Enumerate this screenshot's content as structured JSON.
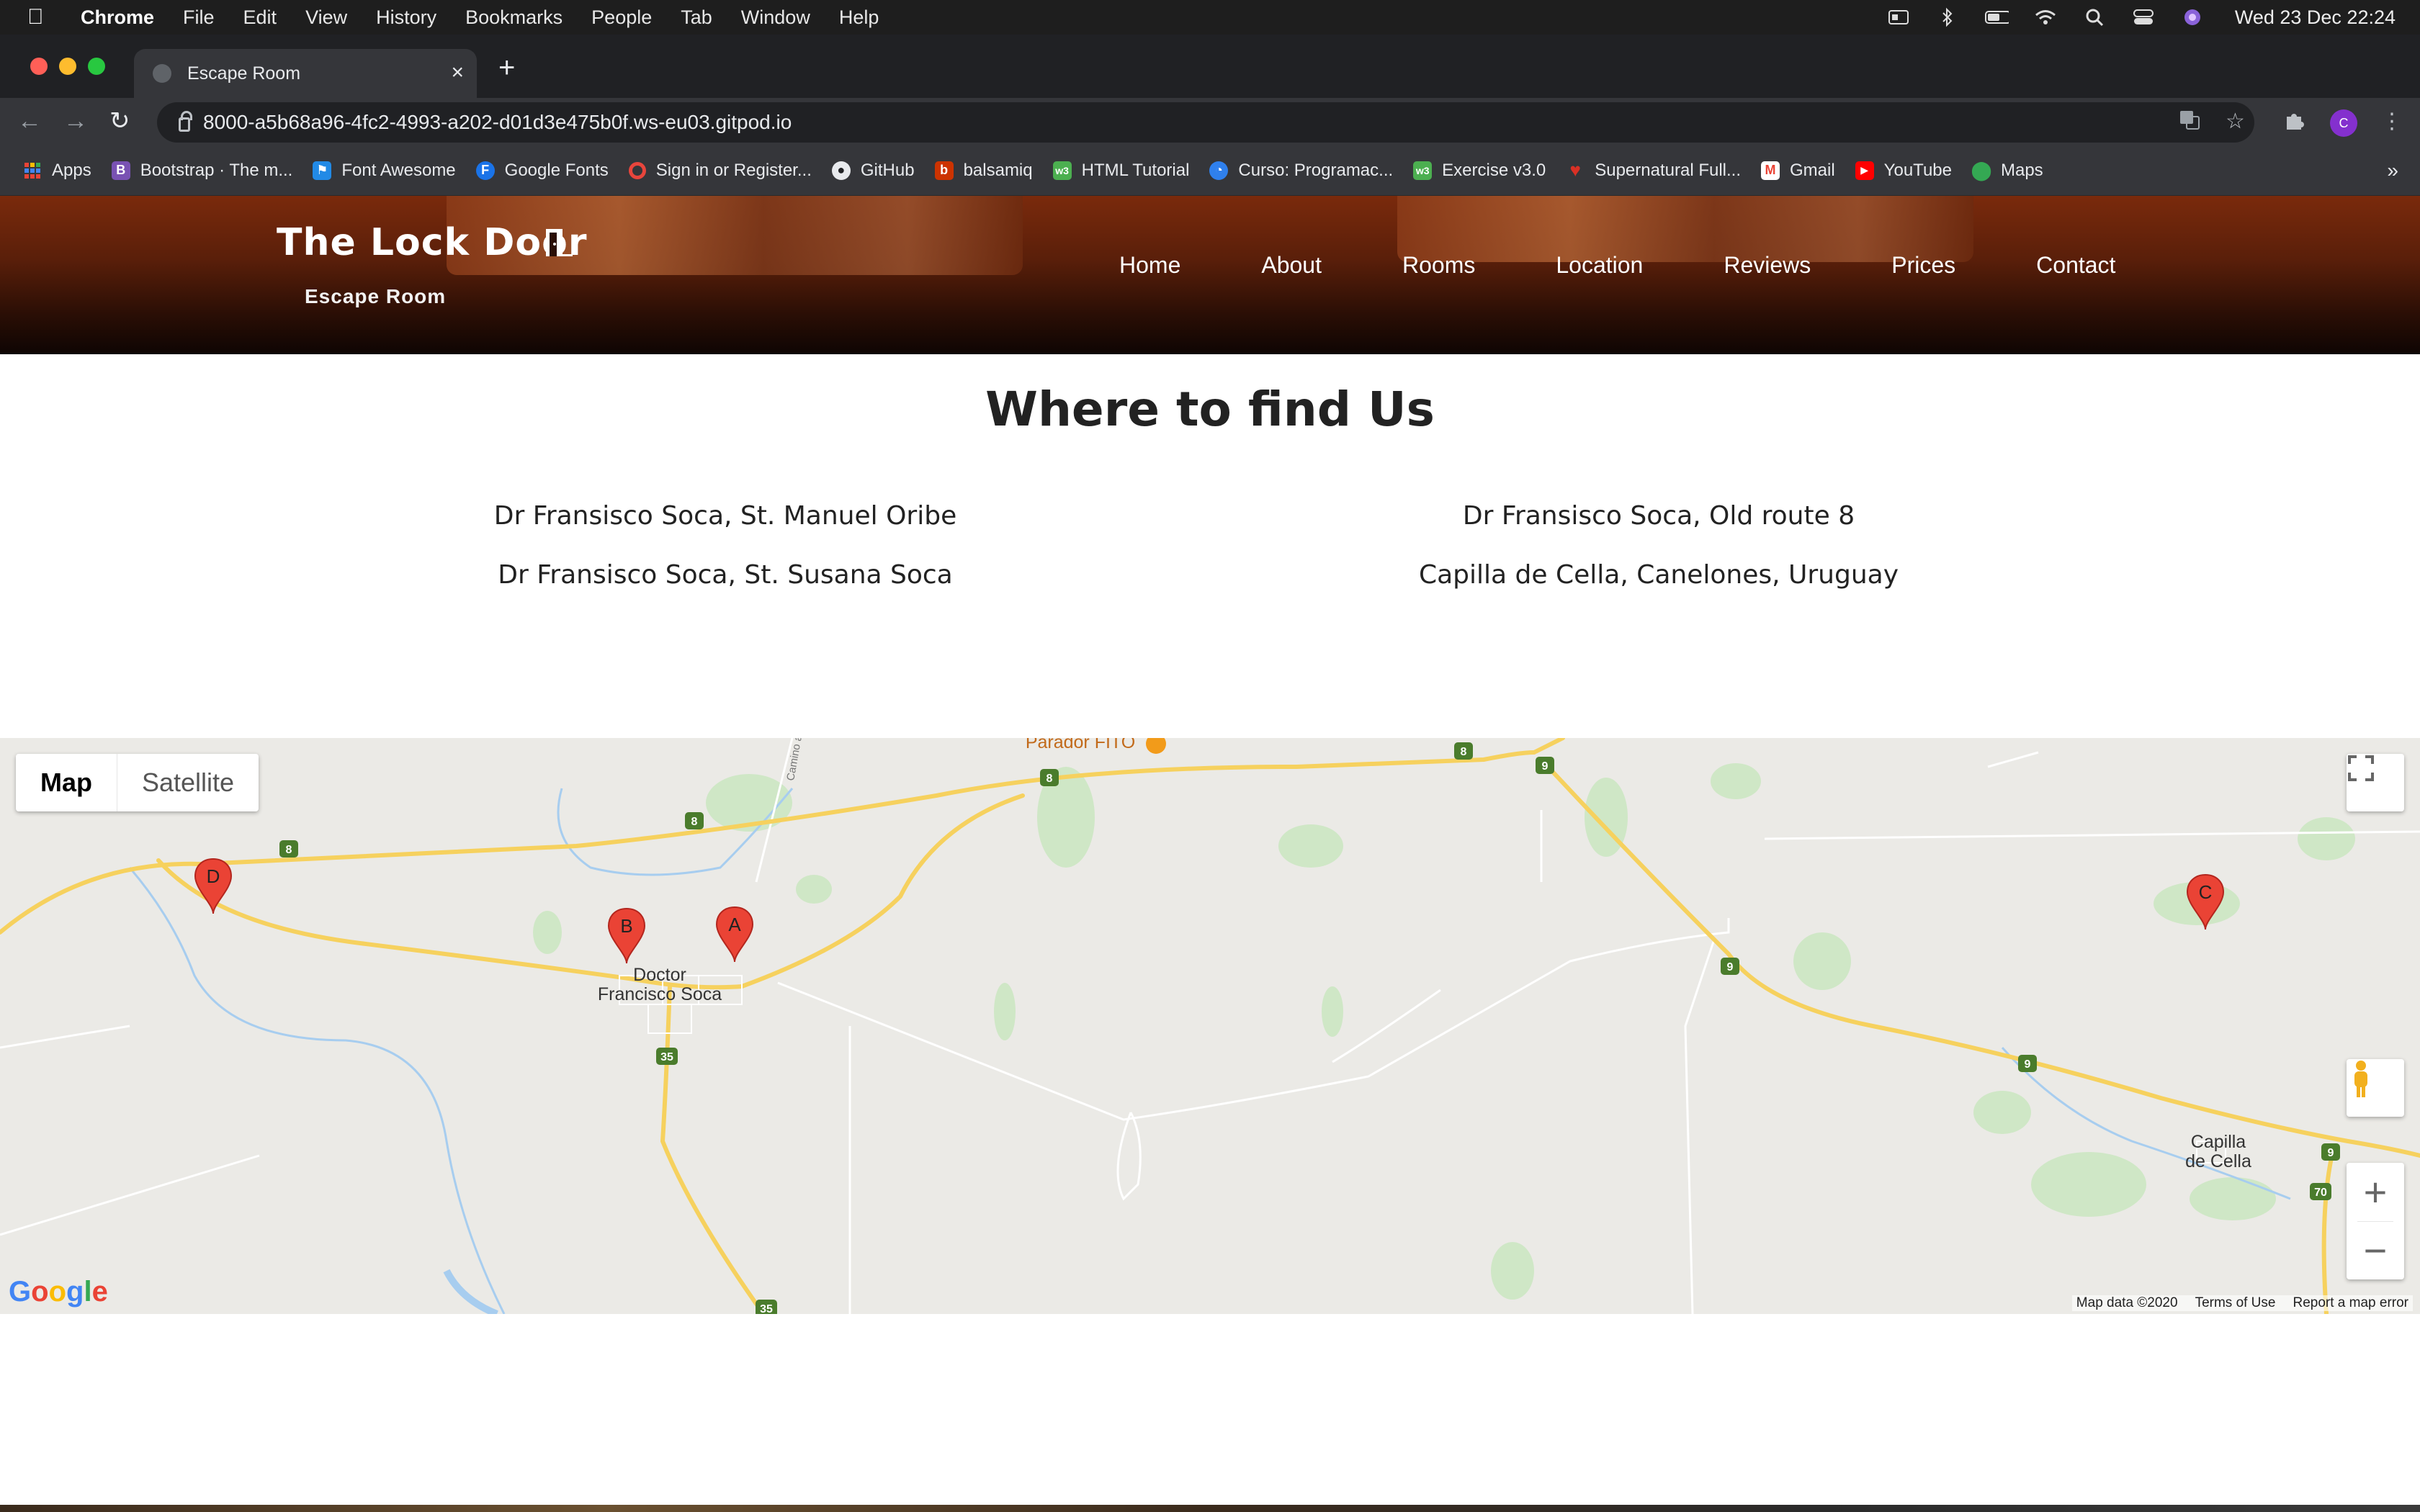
{
  "menubar": {
    "app_name": "Chrome",
    "items": [
      "File",
      "Edit",
      "View",
      "History",
      "Bookmarks",
      "People",
      "Tab",
      "Window",
      "Help"
    ],
    "clock": "Wed 23 Dec  22:24"
  },
  "browser": {
    "tab_title": "Escape Room",
    "url": "8000-a5b68a96-4fc2-4993-a202-d01d3e475b0f.ws-eu03.gitpod.io",
    "profile_initial": "C",
    "bookmarks": [
      {
        "label": "Apps",
        "icon": "apps-grid-icon",
        "color": "#4285f4"
      },
      {
        "label": "Bootstrap · The m...",
        "icon": "bootstrap-icon",
        "color": "#7952b3"
      },
      {
        "label": "Font Awesome",
        "icon": "flag-icon",
        "color": "#228ae6"
      },
      {
        "label": "Google Fonts",
        "icon": "google-fonts-icon",
        "color": "#1a73e8"
      },
      {
        "label": "Sign in or Register...",
        "icon": "ring-icon",
        "color": "#e8453c"
      },
      {
        "label": "GitHub",
        "icon": "github-icon",
        "color": "#e8eaed"
      },
      {
        "label": "balsamiq",
        "icon": "balsamiq-icon",
        "color": "#cc3300"
      },
      {
        "label": "HTML Tutorial",
        "icon": "w3-icon",
        "color": "#4caf50"
      },
      {
        "label": "Curso: Programac...",
        "icon": "course-icon",
        "color": "#2f80ed"
      },
      {
        "label": "Exercise v3.0",
        "icon": "w3-icon",
        "color": "#4caf50"
      },
      {
        "label": "Supernatural Full...",
        "icon": "heart-icon",
        "color": "#d93025"
      },
      {
        "label": "Gmail",
        "icon": "gmail-icon",
        "color": "#ea4335"
      },
      {
        "label": "YouTube",
        "icon": "youtube-icon",
        "color": "#ff0000"
      },
      {
        "label": "Maps",
        "icon": "maps-pin-icon",
        "color": "#34a853"
      }
    ],
    "more": "»"
  },
  "site": {
    "brand_title": "The Lock Door",
    "brand_subtitle": "Escape Room",
    "nav": [
      "Home",
      "About",
      "Rooms",
      "Location",
      "Reviews",
      "Prices",
      "Contact"
    ]
  },
  "main": {
    "title": "Where to find Us",
    "addresses": {
      "left": [
        "Dr Fransisco Soca, St. Manuel Oribe",
        "Dr Fransisco Soca, St. Susana Soca"
      ],
      "right": [
        "Dr Fransisco Soca, Old route 8",
        "Capilla de Cella, Canelones, Uruguay"
      ]
    }
  },
  "map": {
    "type_buttons": [
      "Map",
      "Satellite"
    ],
    "active_type": "Map",
    "markers": [
      "A",
      "B",
      "C",
      "D"
    ],
    "places": [
      "Doctor",
      "Francisco Soca",
      "Capilla",
      "de Cella",
      "Parador FITO",
      "Camino a S"
    ],
    "route_shields": [
      "8",
      "8",
      "8",
      "8",
      "9",
      "9",
      "9",
      "9",
      "35",
      "35",
      "70"
    ],
    "zoom_in": "+",
    "zoom_out": "−",
    "logo": "Google",
    "attribution": [
      "Map data ©2020",
      "Terms of Use",
      "Report a map error"
    ],
    "colors": {
      "marker": "#ea4335",
      "road": "#f6d15e",
      "water": "#aad3f3",
      "park": "#c8e6c0"
    }
  }
}
